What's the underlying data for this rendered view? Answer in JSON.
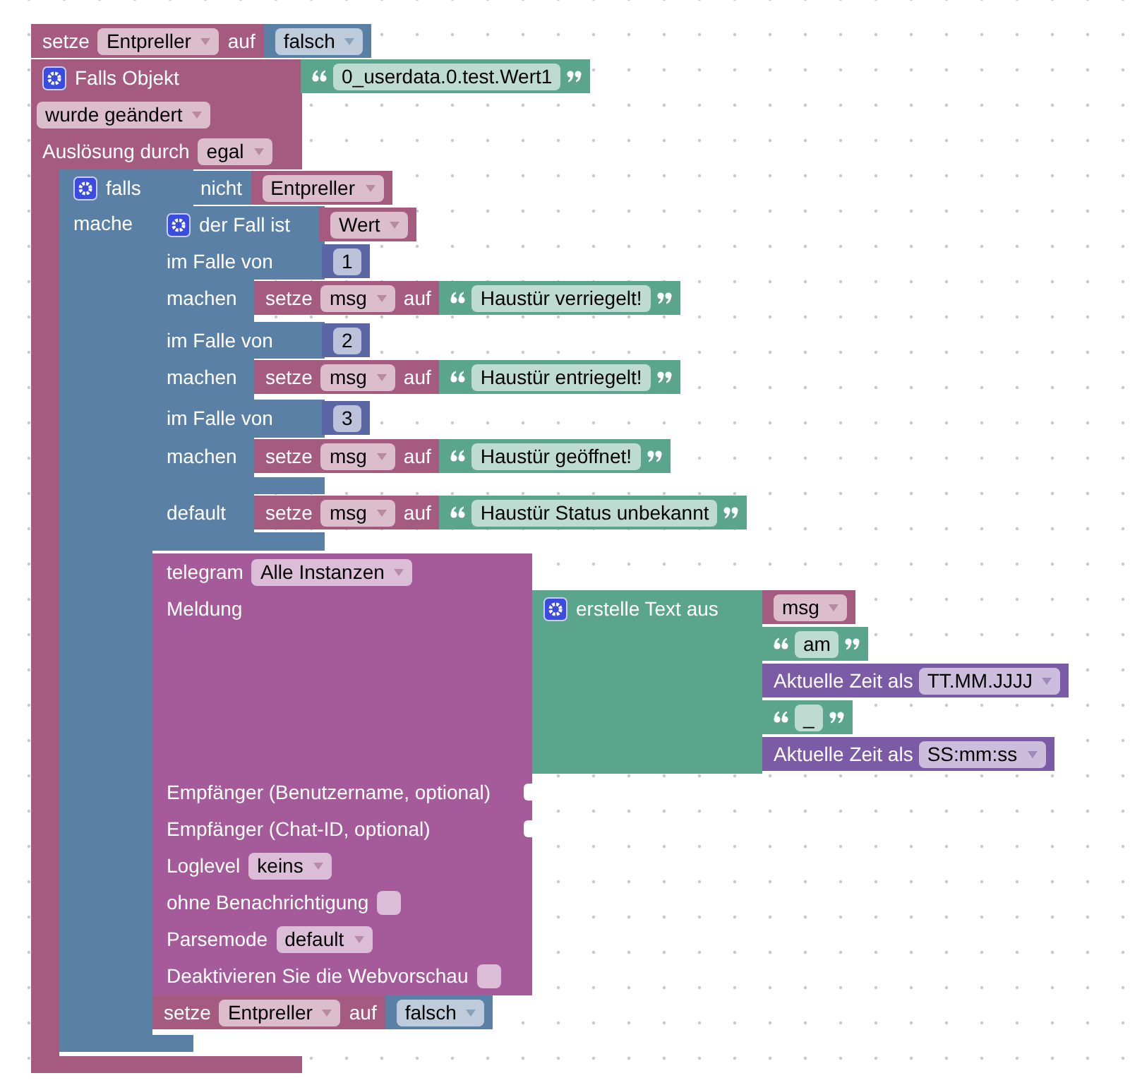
{
  "set_top": {
    "keyword": "setze",
    "variable": "Entpreller",
    "keyword2": "auf",
    "value": "falsch"
  },
  "trigger": {
    "label": "Falls Objekt",
    "object_id": "0_userdata.0.test.Wert1",
    "condition": "wurde geändert",
    "trigger_label": "Auslösung durch",
    "trigger_value": "egal"
  },
  "if_block": {
    "label": "falls",
    "not_label": "nicht",
    "variable": "Entpreller",
    "do_label": "mache"
  },
  "switch": {
    "label": "der Fall ist",
    "variable": "Wert",
    "cases": [
      {
        "label": "im Falle von",
        "value": "1",
        "do_label": "machen",
        "set": {
          "keyword": "setze",
          "variable": "msg",
          "keyword2": "auf",
          "text": "Haustür verriegelt!"
        }
      },
      {
        "label": "im Falle von",
        "value": "2",
        "do_label": "machen",
        "set": {
          "keyword": "setze",
          "variable": "msg",
          "keyword2": "auf",
          "text": "Haustür entriegelt!"
        }
      },
      {
        "label": "im Falle von",
        "value": "3",
        "do_label": "machen",
        "set": {
          "keyword": "setze",
          "variable": "msg",
          "keyword2": "auf",
          "text": "Haustür geöffnet!"
        }
      }
    ],
    "default": {
      "label": "default",
      "set": {
        "keyword": "setze",
        "variable": "msg",
        "keyword2": "auf",
        "text": "Haustür Status unbekannt"
      }
    }
  },
  "telegram": {
    "label": "telegram",
    "instance": "Alle Instanzen",
    "message_label": "Meldung",
    "join": {
      "label": "erstelle Text aus",
      "items": [
        {
          "kind": "variable",
          "value": "msg"
        },
        {
          "kind": "text",
          "value": "am"
        },
        {
          "kind": "time",
          "label": "Aktuelle Zeit als",
          "value": "TT.MM.JJJJ"
        },
        {
          "kind": "text",
          "value": "_"
        },
        {
          "kind": "time",
          "label": "Aktuelle Zeit als",
          "value": "SS:mm:ss"
        }
      ]
    },
    "rows": [
      {
        "kind": "input",
        "label": "Empfänger (Benutzername, optional)"
      },
      {
        "kind": "input",
        "label": "Empfänger (Chat-ID, optional)"
      },
      {
        "kind": "dropdown",
        "label": "Loglevel",
        "value": "keins"
      },
      {
        "kind": "checkbox",
        "label": "ohne Benachrichtigung",
        "checked": false
      },
      {
        "kind": "dropdown",
        "label": "Parsemode",
        "value": "default"
      },
      {
        "kind": "checkbox",
        "label": "Deaktivieren Sie die Webvorschau",
        "checked": false
      }
    ]
  },
  "set_bottom": {
    "keyword": "setze",
    "variable": "Entpreller",
    "keyword2": "auf",
    "value": "falsch"
  }
}
